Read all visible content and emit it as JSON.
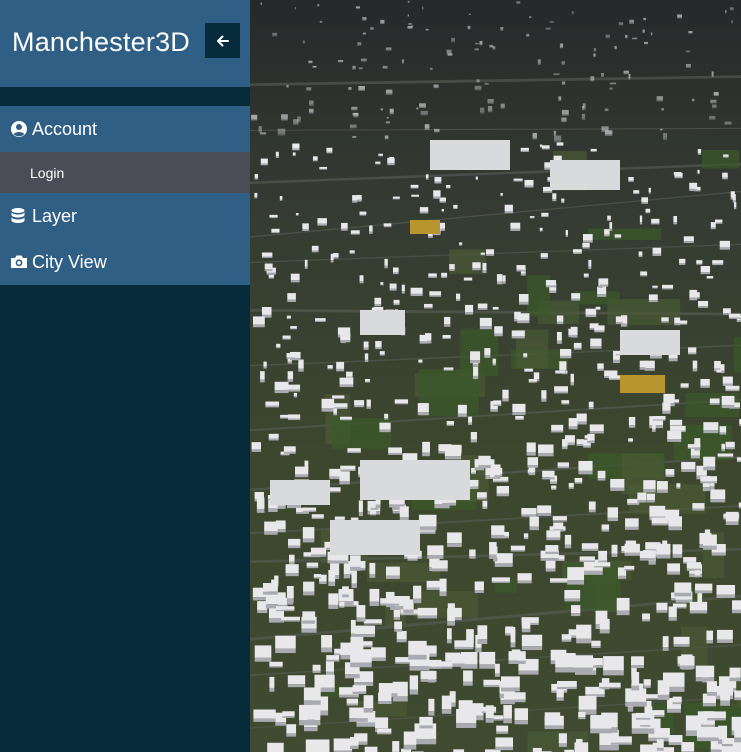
{
  "app": {
    "title": "Manchester3D"
  },
  "sidebar": {
    "collapse_icon": "arrow-left-icon",
    "menu": [
      {
        "label": "Account",
        "icon": "user-circle-icon",
        "children": [
          {
            "label": "Login"
          }
        ]
      },
      {
        "label": "Layer",
        "icon": "database-icon"
      },
      {
        "label": "City View",
        "icon": "camera-icon"
      }
    ]
  },
  "map": {
    "description_colors": {
      "buildings": "#e8e8ea",
      "ground": "#3d4a2e",
      "highlight": "#b8952e"
    }
  }
}
